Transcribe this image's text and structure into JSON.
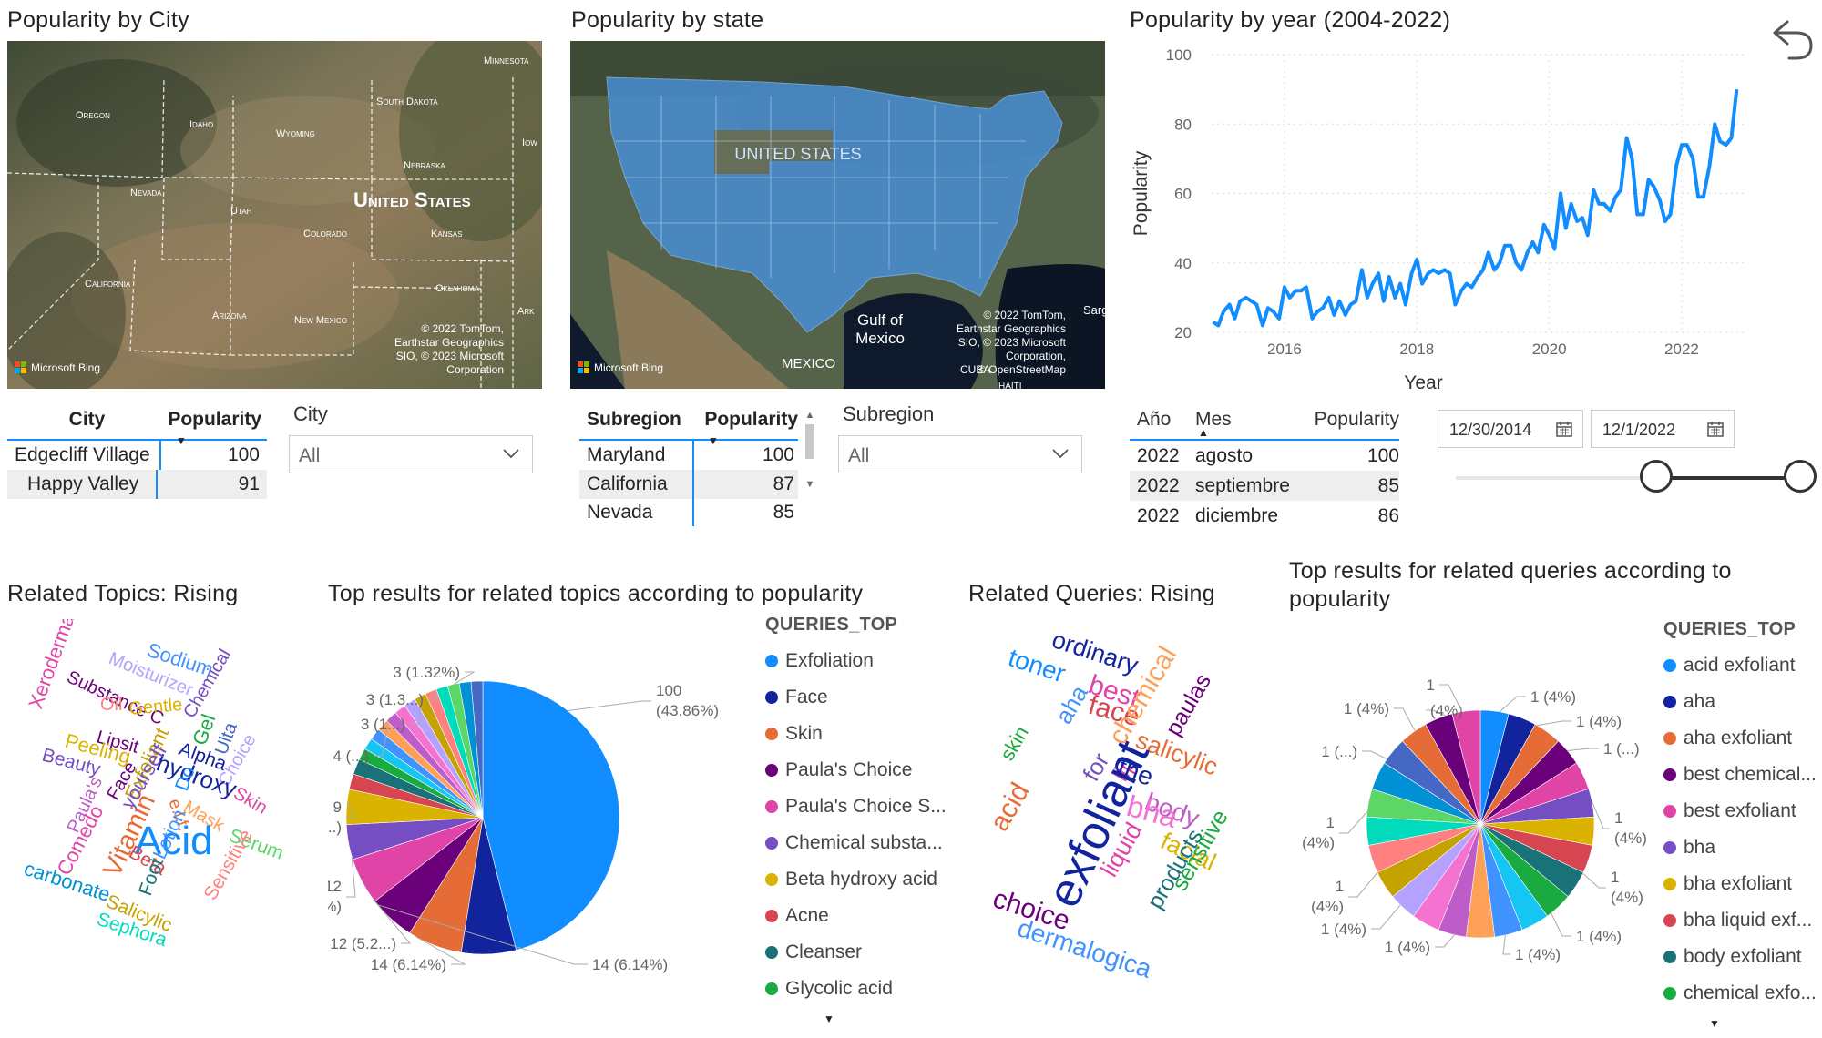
{
  "city_panel": {
    "title": "Popularity by City",
    "map_labels": [
      "Oregon",
      "Idaho",
      "Wyoming",
      "South Dakota",
      "Minnesota",
      "Nebraska",
      "Nevada",
      "Utah",
      "United States",
      "Colorado",
      "Kansas",
      "Iowa",
      "California",
      "Oklahoma",
      "Arizona",
      "New Mexico",
      "Ark"
    ],
    "copyright": "© 2022 TomTom, Earthstar Geographics SIO, © 2023 Microsoft Corporation",
    "bing": "Microsoft Bing",
    "table": {
      "headers": [
        "City",
        "Popularity"
      ],
      "rows": [
        [
          "Edgecliff Village",
          "100"
        ],
        [
          "Happy Valley",
          "91"
        ]
      ]
    },
    "slicer": {
      "label": "City",
      "value": "All"
    }
  },
  "state_panel": {
    "title": "Popularity by state",
    "map_labels": {
      "country": "UNITED STATES",
      "gulf": "Gulf of Mexico",
      "mexico": "MEXICO",
      "cuba": "CUBA",
      "haiti": "HAITI",
      "sarg": "Sarg"
    },
    "copyright": "© 2022 TomTom, Earthstar Geographics SIO, © 2023 Microsoft Corporation, © OpenStreetMap",
    "bing": "Microsoft Bing",
    "table": {
      "headers": [
        "Subregion",
        "Popularity"
      ],
      "rows": [
        [
          "Maryland",
          "100"
        ],
        [
          "California",
          "87"
        ],
        [
          "Nevada",
          "85"
        ]
      ]
    },
    "slicer": {
      "label": "Subregion",
      "value": "All"
    }
  },
  "year_panel": {
    "title": "Popularity by year (2004-2022)",
    "table": {
      "headers": [
        "Año",
        "Mes",
        "Popularity"
      ],
      "rows": [
        [
          "2022",
          "agosto",
          "100"
        ],
        [
          "2022",
          "septiembre",
          "85"
        ],
        [
          "2022",
          "diciembre",
          "86"
        ]
      ]
    },
    "date_start": "12/30/2014",
    "date_end": "12/1/2022"
  },
  "chart_data": [
    {
      "type": "line",
      "title": "Popularity by year (2004-2022)",
      "xlabel": "Year",
      "ylabel": "Popularity",
      "ylim": [
        20,
        100
      ],
      "xlim": [
        2014.9,
        2022.95
      ],
      "x_ticks": [
        "2016",
        "2018",
        "2020",
        "2022"
      ],
      "y_ticks": [
        "20",
        "40",
        "60",
        "80",
        "100"
      ],
      "color": "#118DFF",
      "x": [
        2014.92,
        2015.0,
        2015.08,
        2015.17,
        2015.25,
        2015.33,
        2015.42,
        2015.5,
        2015.58,
        2015.67,
        2015.75,
        2015.83,
        2015.92,
        2016.0,
        2016.08,
        2016.17,
        2016.25,
        2016.33,
        2016.42,
        2016.5,
        2016.58,
        2016.67,
        2016.75,
        2016.83,
        2016.92,
        2017.0,
        2017.08,
        2017.17,
        2017.25,
        2017.33,
        2017.42,
        2017.5,
        2017.58,
        2017.67,
        2017.75,
        2017.83,
        2017.92,
        2018.0,
        2018.08,
        2018.17,
        2018.25,
        2018.33,
        2018.42,
        2018.5,
        2018.58,
        2018.67,
        2018.75,
        2018.83,
        2018.92,
        2019.0,
        2019.08,
        2019.17,
        2019.25,
        2019.33,
        2019.42,
        2019.5,
        2019.58,
        2019.67,
        2019.75,
        2019.83,
        2019.92,
        2020.0,
        2020.08,
        2020.17,
        2020.25,
        2020.33,
        2020.42,
        2020.5,
        2020.58,
        2020.67,
        2020.75,
        2020.83,
        2020.92,
        2021.0,
        2021.08,
        2021.17,
        2021.25,
        2021.33,
        2021.42,
        2021.5,
        2021.58,
        2021.67,
        2021.75,
        2021.83,
        2021.92,
        2022.0,
        2022.08,
        2022.17,
        2022.25,
        2022.33,
        2022.42,
        2022.5,
        2022.58,
        2022.67,
        2022.75,
        2022.83
      ],
      "values": [
        23,
        22,
        26,
        28,
        24,
        29,
        30,
        29,
        28,
        22,
        27,
        26,
        24,
        33,
        30,
        32,
        32,
        33,
        24,
        26,
        27,
        30,
        25,
        29,
        25,
        28,
        29,
        38,
        30,
        34,
        37,
        29,
        36,
        30,
        34,
        28,
        37,
        41,
        34,
        37,
        38,
        37,
        38,
        37,
        28,
        32,
        34,
        33,
        36,
        38,
        43,
        38,
        40,
        45,
        45,
        40,
        38,
        43,
        46,
        43,
        51,
        48,
        44,
        60,
        50,
        57,
        52,
        53,
        48,
        61,
        57,
        57,
        55,
        59,
        61,
        76,
        70,
        54,
        54,
        64,
        62,
        58,
        52,
        54,
        68,
        74,
        74,
        70,
        59,
        59,
        68,
        80,
        75,
        74,
        76,
        90
      ]
    },
    {
      "type": "pie",
      "title": "Top results for related topics according to popularity",
      "legend_title": "QUERIES_TOP",
      "legend_placement": "right",
      "categories": [
        "Exfoliation",
        "Face",
        "Skin",
        "Paula's Choice",
        "Paula's Choice S...",
        "Chemical substa...",
        "Beta hydroxy acid",
        "Acne",
        "Cleanser",
        "Glycolic acid",
        "other",
        "other",
        "other",
        "other",
        "other",
        "other",
        "other",
        "other",
        "other",
        "other",
        "other",
        "other"
      ],
      "values": [
        100,
        14,
        14,
        12,
        12,
        9,
        9,
        4,
        4,
        3,
        3,
        3,
        3,
        3,
        3,
        3,
        3,
        3,
        3,
        3,
        3,
        3
      ],
      "data_labels": [
        "100 (43.86%)",
        "14 (6.14%)",
        "14 (6.14%)",
        "12 (5.2...)",
        "12 (5.26%)",
        "9 (3....)",
        "4 (...)",
        "3 (1...)",
        "3 (1.3...)",
        "3 (1.32%)"
      ],
      "colors": [
        "#118DFF",
        "#12239E",
        "#E66C37",
        "#6B007B",
        "#E044A7",
        "#744EC2",
        "#D9B300",
        "#D64550",
        "#197278",
        "#1AAB40",
        "#15C6F4",
        "#4092FF",
        "#FFA058",
        "#BE5DC9",
        "#F472D0",
        "#B5A1FF",
        "#C4A200",
        "#FF8080",
        "#00DBBC",
        "#5BD667",
        "#0091D5",
        "#4668C5"
      ]
    },
    {
      "type": "pie",
      "title": "Top results for related queries according to popularity",
      "legend_title": "QUERIES_TOP",
      "legend_placement": "right",
      "categories": [
        "acid exfoliant",
        "aha",
        "aha exfoliant",
        "best chemical...",
        "best exfoliant",
        "bha",
        "bha exfoliant",
        "bha liquid exf...",
        "body exfoliant",
        "chemical exfo...",
        "other",
        "other",
        "other",
        "other",
        "other",
        "other",
        "other",
        "other",
        "other",
        "other",
        "other",
        "other",
        "other",
        "other",
        "other"
      ],
      "values": [
        1,
        1,
        1,
        1,
        1,
        1,
        1,
        1,
        1,
        1,
        1,
        1,
        1,
        1,
        1,
        1,
        1,
        1,
        1,
        1,
        1,
        1,
        1,
        1,
        1
      ],
      "data_labels": [
        "1 (4%)",
        "1 (4%)",
        "1 (...)",
        "1 (4%)",
        "1 (4%)",
        "1 (4%)",
        "1 (4%)",
        "1 (4%)",
        "1 (4%)",
        "1 (4%)",
        "1 (4%)",
        "1 (...)",
        "1 (4%)",
        "(4%)",
        "1"
      ],
      "colors": [
        "#118DFF",
        "#12239E",
        "#E66C37",
        "#6B007B",
        "#E044A7",
        "#744EC2",
        "#D9B300",
        "#D64550",
        "#197278",
        "#1AAB40",
        "#15C6F4",
        "#4092FF",
        "#FFA058",
        "#BE5DC9",
        "#F472D0",
        "#B5A1FF",
        "#C4A200",
        "#FF8080",
        "#00DBBC",
        "#5BD667",
        "#0091D5",
        "#4668C5",
        "#E66C37",
        "#6B007B",
        "#E044A7"
      ]
    }
  ],
  "wordcloud_topics": {
    "title": "Related Topics: Rising",
    "words": [
      {
        "t": "Xeroderma",
        "c": "#E044A7"
      },
      {
        "t": "Substance C",
        "c": "#6B007B"
      },
      {
        "t": "Moisturizer",
        "c": "#B5A1FF"
      },
      {
        "t": "Sodium",
        "c": "#4092FF"
      },
      {
        "t": "Chemical",
        "c": "#744EC2"
      },
      {
        "t": "Oil",
        "c": "#FF8080"
      },
      {
        "t": "Gentle",
        "c": "#D9B300"
      },
      {
        "t": "Lipsit",
        "c": "#6B007B"
      },
      {
        "t": "Gel",
        "c": "#1AAB40"
      },
      {
        "t": "Ulta",
        "c": "#4668C5"
      },
      {
        "t": "Peeling",
        "c": "#D9B300"
      },
      {
        "t": "Beauty",
        "c": "#744EC2"
      },
      {
        "t": "Alpha",
        "c": "#12239E"
      },
      {
        "t": "Choice",
        "c": "#B5A1FF"
      },
      {
        "t": "Face",
        "c": "#6B007B"
      },
      {
        "t": "Exfoliant",
        "c": "#C4A200"
      },
      {
        "t": "hydroxy",
        "c": "#12239E"
      },
      {
        "t": "Skin",
        "c": "#E044A7"
      },
      {
        "t": "Paula's",
        "c": "#BE5DC9"
      },
      {
        "t": "yourself",
        "c": "#744EC2"
      },
      {
        "t": "e.l.f.",
        "c": "#E66C37"
      },
      {
        "t": "Mask",
        "c": "#FFA058"
      },
      {
        "t": "Serum",
        "c": "#5BD667"
      },
      {
        "t": "Do",
        "c": "#118DFF"
      },
      {
        "t": "Comedo",
        "c": "#E044A7"
      },
      {
        "t": "Acid",
        "c": "#118DFF"
      },
      {
        "t": "Vitamin",
        "c": "#E66C37"
      },
      {
        "t": "Beta",
        "c": "#D64550"
      },
      {
        "t": "Lotion",
        "c": "#4092FF"
      },
      {
        "t": "Sensitive",
        "c": "#FF8080"
      },
      {
        "t": "Foot",
        "c": "#197278"
      },
      {
        "t": "carbonate",
        "c": "#0091D5"
      },
      {
        "t": "Salicylic",
        "c": "#C4A200"
      },
      {
        "t": "Sephora",
        "c": "#00DBBC"
      }
    ]
  },
  "wordcloud_queries": {
    "title": "Related Queries: Rising",
    "words": [
      {
        "t": "ordinary",
        "c": "#12239E"
      },
      {
        "t": "toner",
        "c": "#118DFF"
      },
      {
        "t": "best",
        "c": "#E044A7"
      },
      {
        "t": "paulas",
        "c": "#6B007B"
      },
      {
        "t": "aha",
        "c": "#4092FF"
      },
      {
        "t": "face",
        "c": "#D64550"
      },
      {
        "t": "chemical",
        "c": "#FFA058"
      },
      {
        "t": "skin",
        "c": "#1AAB40"
      },
      {
        "t": "for",
        "c": "#744EC2"
      },
      {
        "t": "lip",
        "c": "#E044A7"
      },
      {
        "t": "salicylic",
        "c": "#E66C37"
      },
      {
        "t": "the",
        "c": "#12239E"
      },
      {
        "t": "body",
        "c": "#BE5DC9"
      },
      {
        "t": "exfoliant",
        "c": "#12239E"
      },
      {
        "t": "acid",
        "c": "#E66C37"
      },
      {
        "t": "bha",
        "c": "#F472D0"
      },
      {
        "t": "liquid",
        "c": "#E044A7"
      },
      {
        "t": "facial",
        "c": "#D9B300"
      },
      {
        "t": "products",
        "c": "#197278"
      },
      {
        "t": "sensitive",
        "c": "#1AAB40"
      },
      {
        "t": "choice",
        "c": "#6B007B"
      },
      {
        "t": "dermalogica",
        "c": "#4092FF"
      }
    ]
  },
  "icons": {
    "back": "undo-arrow-icon",
    "calendar": "calendar-icon",
    "chevron": "chevron-down-icon",
    "sort": "sort-arrow-icon"
  }
}
